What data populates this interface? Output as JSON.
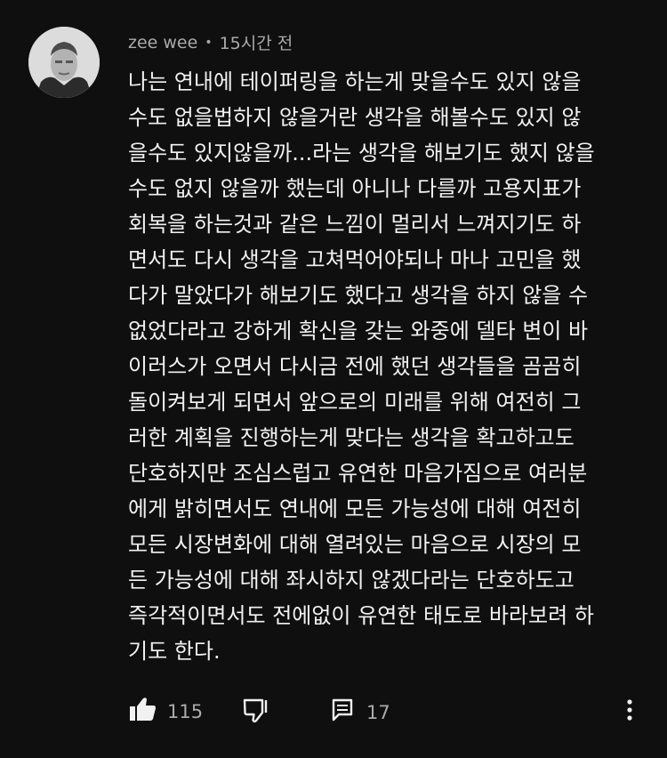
{
  "comment": {
    "author": "zee wee",
    "separator": "•",
    "time": "15시간 전",
    "lines": [
      "나는 연내에 테이퍼링을 하는게 맞을수도 있지 않을",
      "수도 없을법하지 않을거란 생각을 해볼수도 있지 않",
      "을수도 있지않을까...라는 생각을 해보기도 했지 않을",
      "수도 없지 않을까 했는데 아니나 다를까 고용지표가",
      "회복을 하는것과 같은 느낌이 멀리서 느껴지기도 하",
      "면서도 다시 생각을 고쳐먹어야되나 마나 고민을 했",
      "다가 말았다가 해보기도 했다고 생각을 하지 않을 수",
      "없었다라고 강하게 확신을 갖는 와중에 델타 변이 바",
      "이러스가 오면서 다시금 전에 했던 생각들을 곰곰히",
      "돌이켜보게 되면서 앞으로의 미래를 위해 여전히 그",
      "러한 계획을 진행하는게 맞다는 생각을 확고하고도",
      "단호하지만 조심스럽고 유연한 마음가짐으로 여러분",
      "에게 밝히면서도 연내에 모든 가능성에 대해 여전히",
      "모든 시장변화에 대해 열려있는 마음으로 시장의 모",
      "든 가능성에 대해 좌시하지 않겠다라는 단호하도고",
      "즉각적이면서도 전에없이 유연한 태도로 바라보려 하",
      "기도 한다."
    ],
    "likes": "115",
    "replies": "17"
  },
  "icons": {
    "like": "thumbs-up-icon",
    "dislike": "thumbs-down-icon",
    "reply": "reply-icon",
    "more": "more-vertical-icon"
  },
  "colors": {
    "background": "#0f0f0f",
    "text": "#f1f1f1",
    "secondary": "#aaaaaa"
  }
}
